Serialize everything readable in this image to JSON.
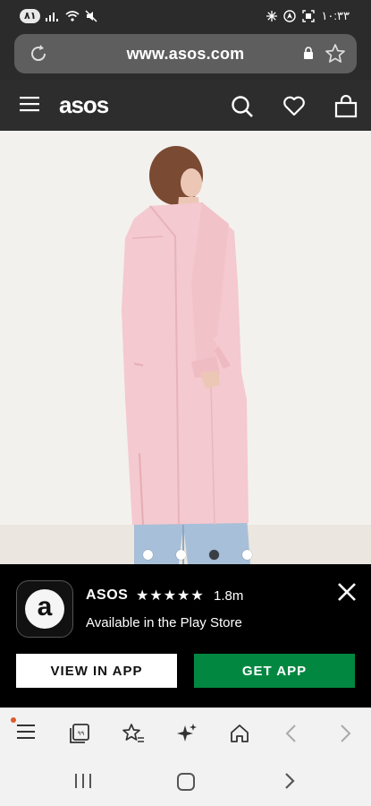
{
  "status_bar": {
    "badge": "٨١",
    "time": "١٠:٣٣"
  },
  "browser": {
    "url": "www.asos.com"
  },
  "site_header": {
    "logo": "asos"
  },
  "carousel": {
    "slide_count": 4,
    "active_index": 2
  },
  "app_banner": {
    "app_name": "ASOS",
    "stars": "★★★★★",
    "rating": "1.8m",
    "availability": "Available in the Play Store",
    "view_in_app_label": "VIEW IN APP",
    "get_app_label": "GET APP"
  },
  "colors": {
    "get_app_green": "#028741",
    "header_bg": "#2d2d2d",
    "coat_pink": "#f4c9cf"
  }
}
